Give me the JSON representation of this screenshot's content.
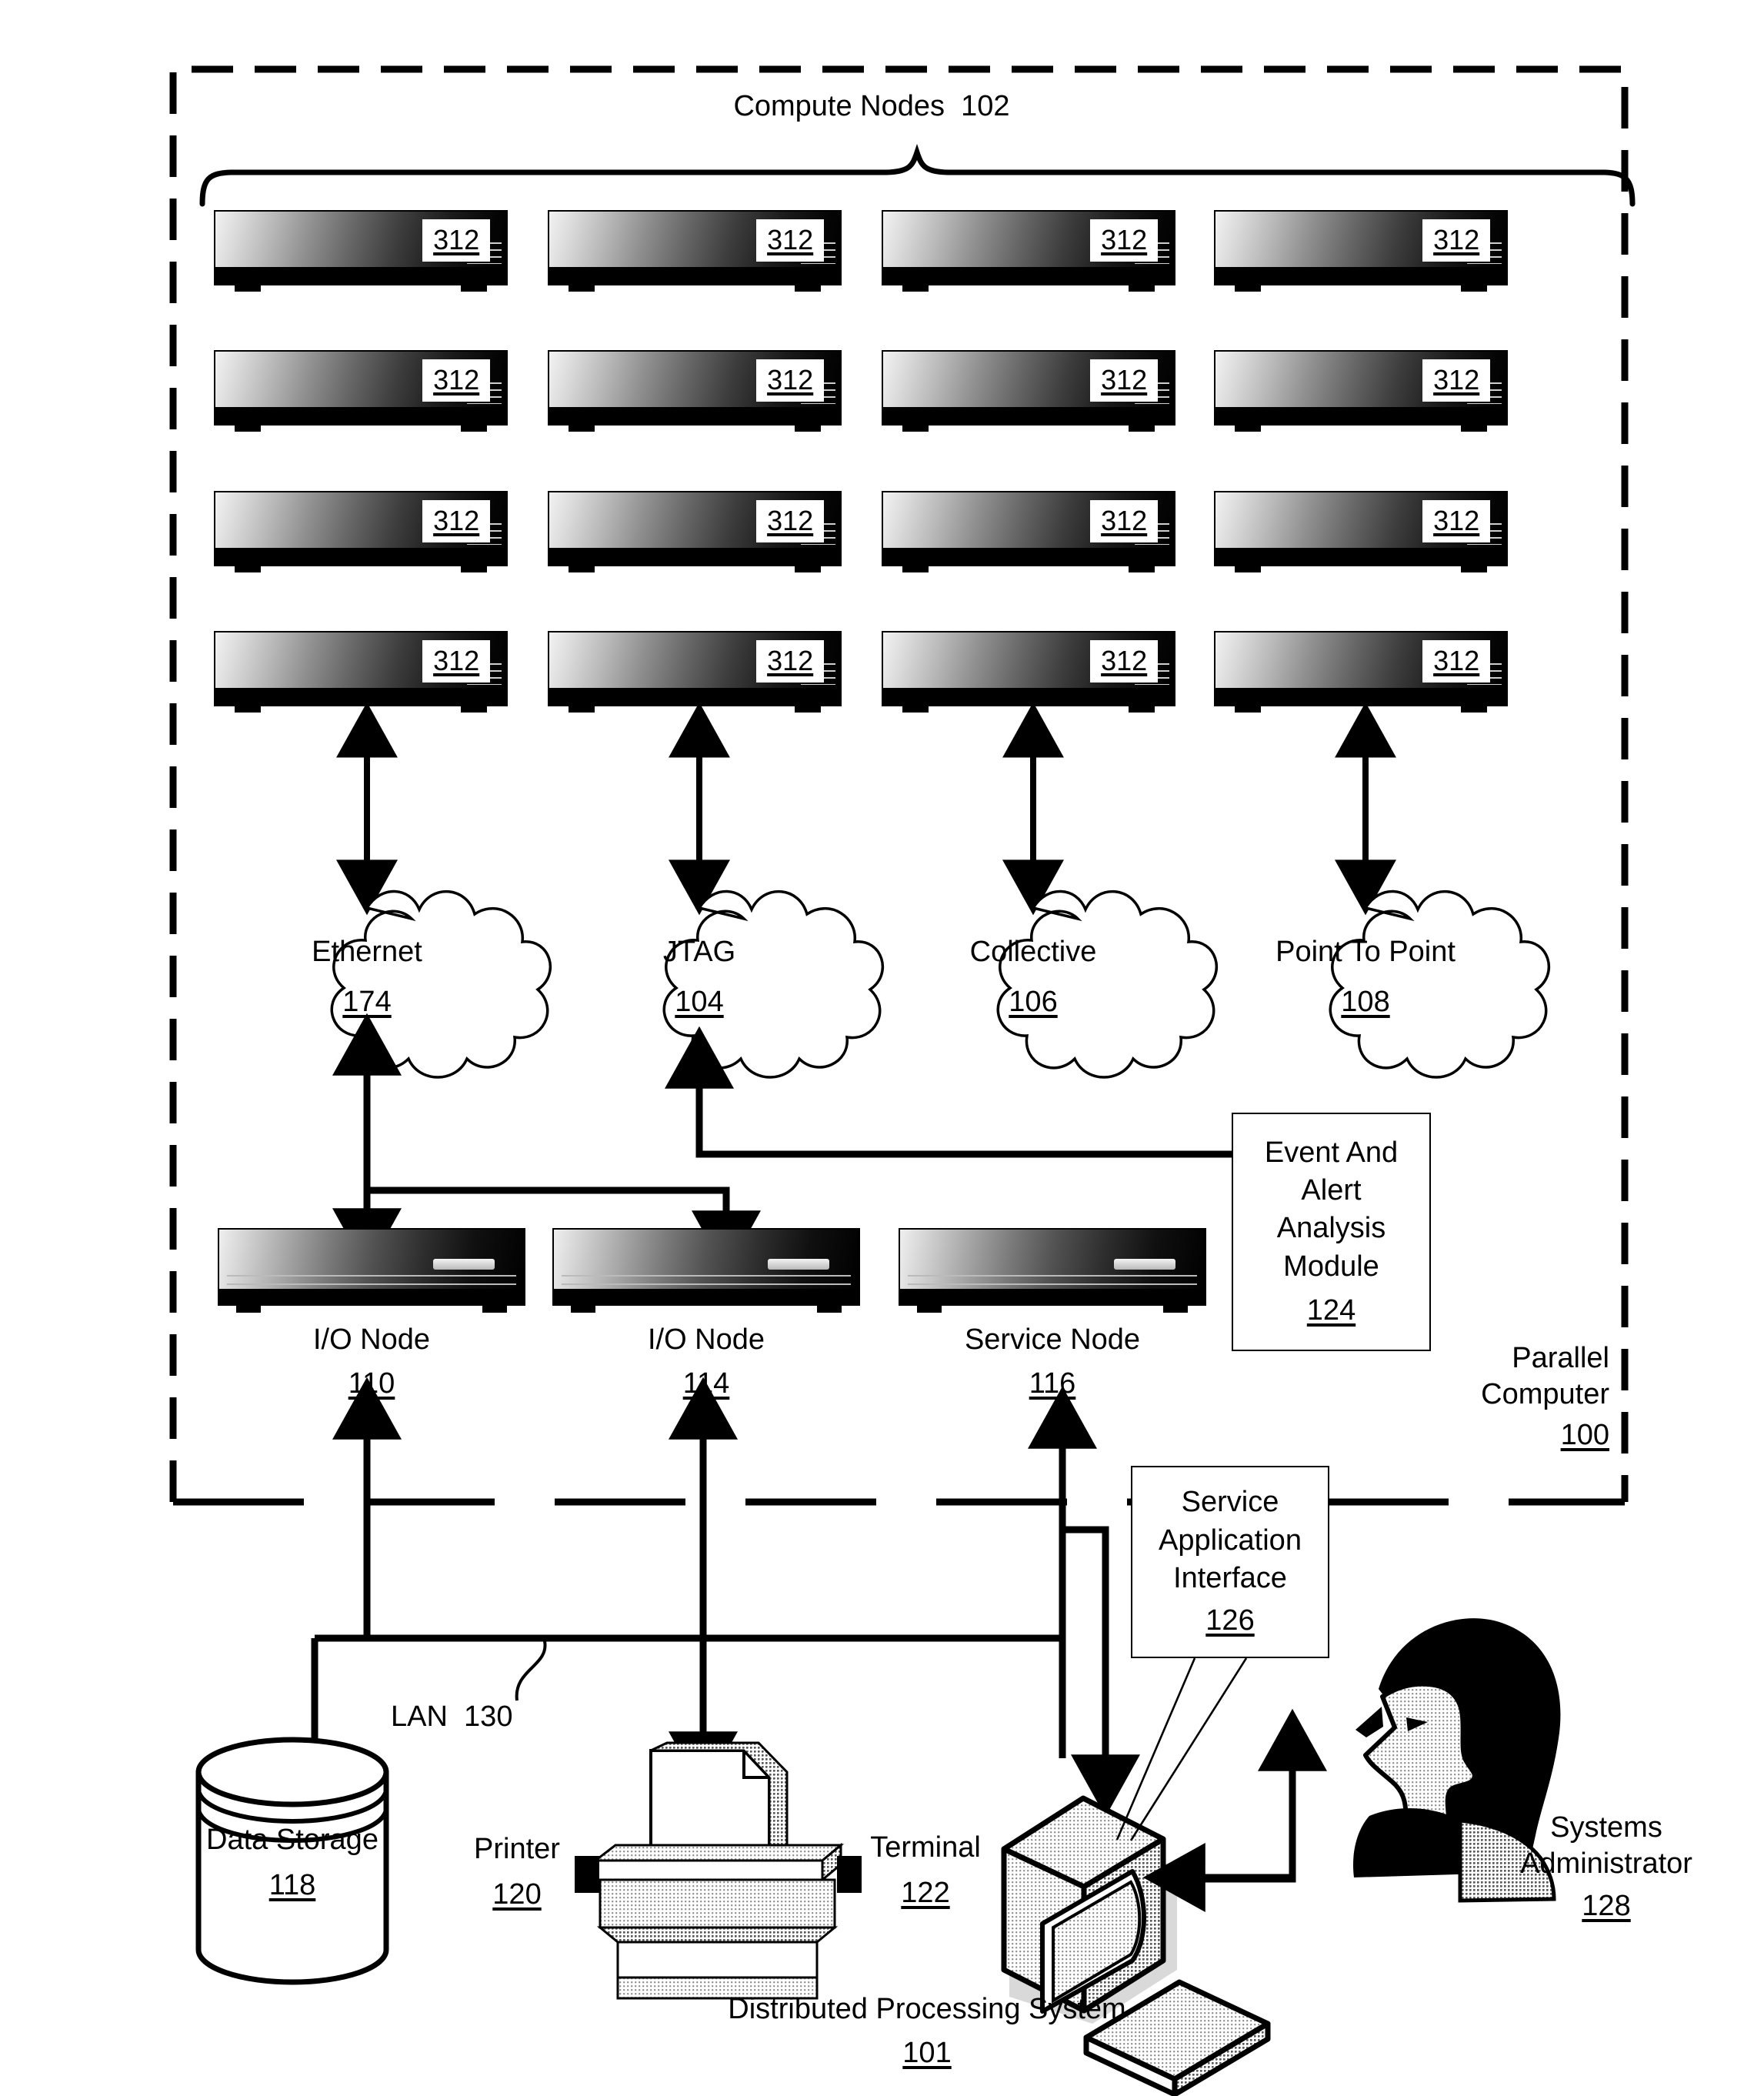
{
  "figure": {
    "title_compute_nodes": "Compute Nodes",
    "title_compute_nodes_ref": "102",
    "bottom_title": "Distributed Processing System",
    "bottom_title_ref": "101",
    "parallel_computer": [
      "Parallel",
      "Computer"
    ],
    "parallel_computer_ref": "100",
    "lan_label": "LAN",
    "lan_ref": "130"
  },
  "compute_nodes": {
    "ref": "312",
    "rows": 4,
    "cols": 4,
    "cells": [
      [
        "312",
        "312",
        "312",
        "312"
      ],
      [
        "312",
        "312",
        "312",
        "312"
      ],
      [
        "312",
        "312",
        "312",
        "312"
      ],
      [
        "312",
        "312",
        "312",
        "312"
      ]
    ]
  },
  "networks": [
    {
      "name": "Ethernet",
      "ref": "174"
    },
    {
      "name": "JTAG",
      "ref": "104"
    },
    {
      "name": "Collective",
      "ref": "106"
    },
    {
      "name": "Point To Point",
      "ref": "108"
    }
  ],
  "service_tier": [
    {
      "name": "I/O Node",
      "ref": "110"
    },
    {
      "name": "I/O Node",
      "ref": "114"
    },
    {
      "name": "Service Node",
      "ref": "116"
    }
  ],
  "modules": [
    {
      "id": "event-alert-analysis-module",
      "lines": [
        "Event And",
        "Alert",
        "Analysis",
        "Module"
      ],
      "ref": "124"
    },
    {
      "id": "service-application-interface",
      "lines": [
        "Service",
        "Application",
        "Interface"
      ],
      "ref": "126"
    }
  ],
  "peripherals": [
    {
      "id": "data-storage",
      "name": "Data Storage",
      "ref": "118"
    },
    {
      "id": "printer",
      "name": "Printer",
      "ref": "120"
    },
    {
      "id": "terminal",
      "name": "Terminal",
      "ref": "122"
    }
  ],
  "actor": {
    "lines": [
      "Systems",
      "Administrator"
    ],
    "ref": "128"
  },
  "colors": {
    "ink": "#000000",
    "paper": "#ffffff"
  }
}
